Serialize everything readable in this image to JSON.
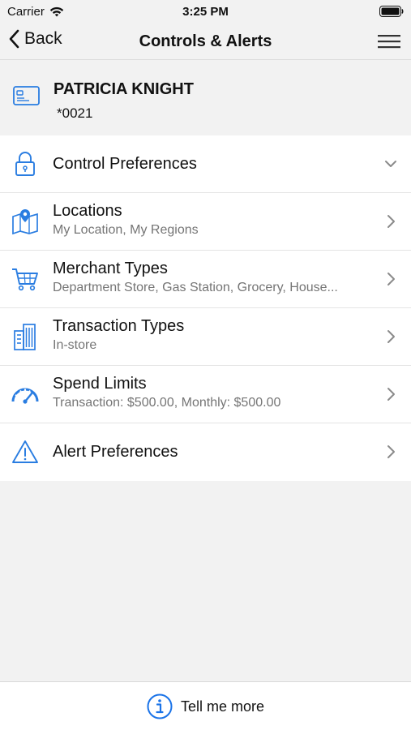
{
  "status_bar": {
    "carrier": "Carrier",
    "time": "3:25 PM"
  },
  "nav": {
    "back_label": "Back",
    "title": "Controls & Alerts"
  },
  "account": {
    "name": "PATRICIA KNIGHT",
    "number": "*0021"
  },
  "items": [
    {
      "label": "Control Preferences",
      "sub": "",
      "icon": "lock-icon",
      "indicator": "chevron-down"
    },
    {
      "label": "Locations",
      "sub": "My Location, My Regions",
      "icon": "map-pin-icon",
      "indicator": "chevron-right"
    },
    {
      "label": "Merchant Types",
      "sub": "Department Store, Gas Station, Grocery, House...",
      "icon": "shopping-cart-icon",
      "indicator": "chevron-right"
    },
    {
      "label": "Transaction Types",
      "sub": "In-store",
      "icon": "buildings-icon",
      "indicator": "chevron-right"
    },
    {
      "label": "Spend Limits",
      "sub": "Transaction: $500.00, Monthly: $500.00",
      "icon": "speedometer-icon",
      "indicator": "chevron-right"
    },
    {
      "label": "Alert Preferences",
      "sub": "",
      "icon": "warning-icon",
      "indicator": "chevron-right"
    }
  ],
  "footer": {
    "label": "Tell me more",
    "icon": "info-icon"
  },
  "colors": {
    "accent": "#1a73e8",
    "icon_blue": "#2a7de1",
    "background": "#f2f2f2"
  }
}
